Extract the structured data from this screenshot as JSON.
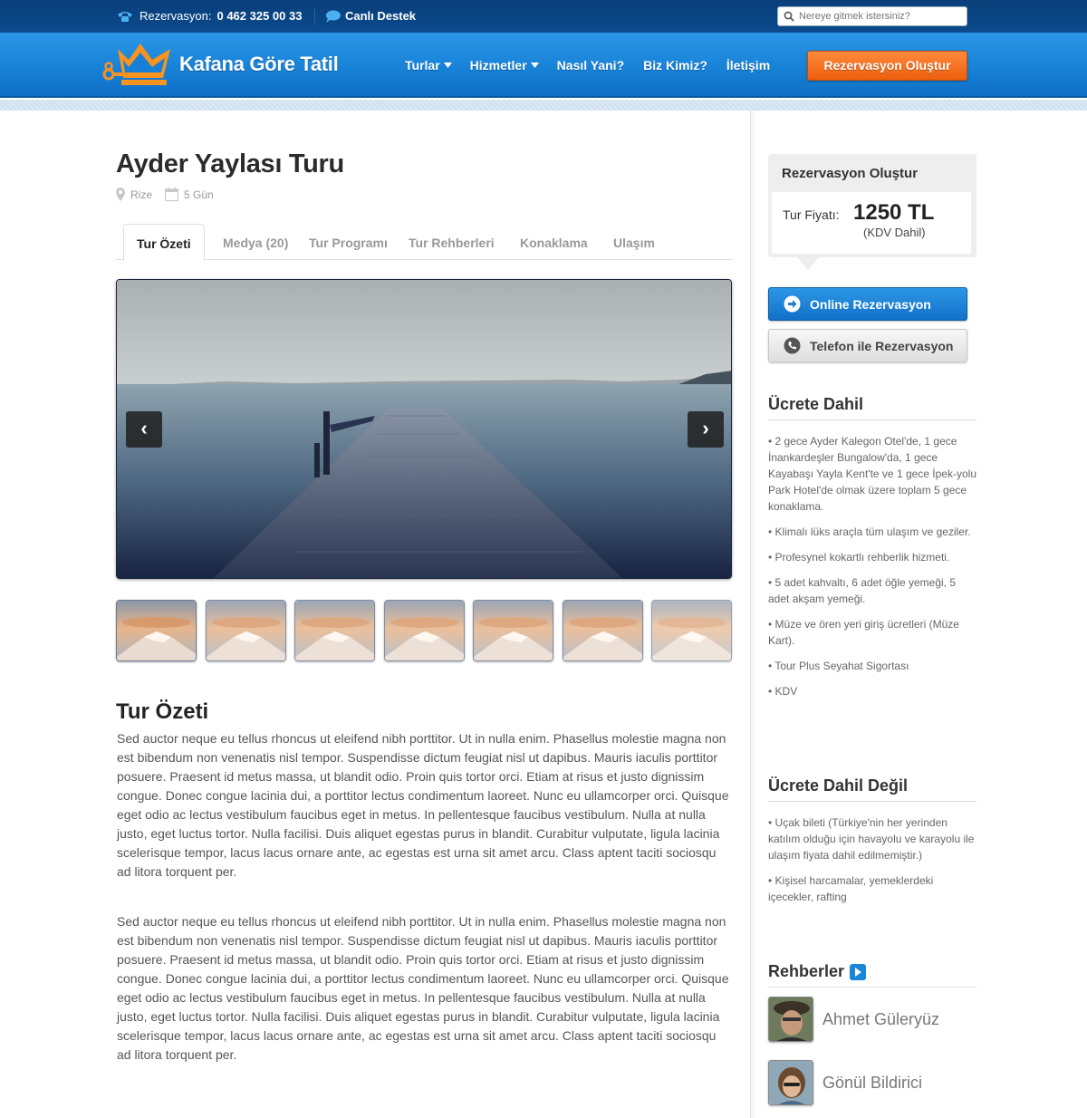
{
  "topbar": {
    "reservation_label": "Rezervasyon:",
    "phone": "0 462 325 00 33",
    "support": "Canlı Destek",
    "search_placeholder": "Nereye gitmek istersiniz?"
  },
  "brand": {
    "name": "Kafana Göre Tatil"
  },
  "nav": {
    "items": [
      "Turlar",
      "Hizmetler",
      "Nasıl Yani?",
      "Biz Kimiz?",
      "İletişim"
    ],
    "cta": "Rezervasyon Oluştur"
  },
  "tour": {
    "title": "Ayder Yaylası Turu",
    "location": "Rize",
    "duration": "5 Gün"
  },
  "tabs": [
    "Tur Özeti",
    "Medya (20)",
    "Tur Programı",
    "Tur Rehberleri",
    "Konaklama",
    "Ulaşım"
  ],
  "summary": {
    "heading": "Tur Özeti",
    "paragraphs": [
      "Sed auctor neque eu tellus rhoncus ut eleifend nibh porttitor. Ut in nulla enim. Phasellus molestie magna non est bibendum non venenatis nisl tempor. Suspendisse dictum feugiat nisl ut dapibus. Mauris iaculis porttitor posuere. Praesent id metus massa, ut blandit odio. Proin quis tortor orci. Etiam at risus et justo dignissim congue. Donec congue lacinia dui, a porttitor lectus condimentum laoreet. Nunc eu ullamcorper orci. Quisque eget odio ac lectus vestibulum faucibus eget in metus. In pellentesque faucibus vestibulum. Nulla at nulla justo, eget luctus tortor. Nulla facilisi. Duis aliquet egestas purus in blandit. Curabitur vulputate, ligula lacinia scelerisque tempor, lacus lacus ornare ante, ac egestas est urna sit amet arcu. Class aptent taciti sociosqu ad litora torquent per.",
      "Sed auctor neque eu tellus rhoncus ut eleifend nibh porttitor. Ut in nulla enim. Phasellus molestie magna non est bibendum non venenatis nisl tempor. Suspendisse dictum feugiat nisl ut dapibus. Mauris iaculis porttitor posuere. Praesent id metus massa, ut blandit odio. Proin quis tortor orci. Etiam at risus et justo dignissim congue. Donec congue lacinia dui, a porttitor lectus condimentum laoreet. Nunc eu ullamcorper orci. Quisque eget odio ac lectus vestibulum faucibus eget in metus. In pellentesque faucibus vestibulum. Nulla at nulla justo, eget luctus tortor. Nulla facilisi. Duis aliquet egestas purus in blandit. Curabitur vulputate, ligula lacinia scelerisque tempor, lacus lacus ornare ante, ac egestas est urna sit amet arcu. Class aptent taciti sociosqu ad litora torquent per."
    ]
  },
  "reservation": {
    "heading": "Rezervasyon Oluştur",
    "price_label": "Tur Fiyatı:",
    "price": "1250 TL",
    "price_note": "(KDV Dahil)",
    "online_button": "Online Rezervasyon",
    "phone_button": "Telefon ile Rezervasyon"
  },
  "included": {
    "heading": "Ücrete Dahil",
    "items": [
      "2 gece Ayder Kalegon Otel'de, 1 gece İnankardeşler Bungalow'da, 1 gece Kayabaşı Yayla Kent'te ve 1 gece İpek-yolu Park Hotel'de olmak üzere toplam 5 gece konaklama.",
      "Klimalı lüks araçla tüm ulaşım ve geziler.",
      "Profesynel kokartlı rehberlik hizmeti.",
      "5 adet kahvaltı, 6 adet öğle yemeği, 5 adet akşam yemeği.",
      "Müze ve ören yeri giriş ücretleri (Müze Kart).",
      "Tour Plus Seyahat Sigortası",
      "KDV"
    ]
  },
  "excluded": {
    "heading": "Ücrete Dahil Değil",
    "items": [
      "Uçak bileti (Türkiye'nin her yerinden katılım olduğu için havayolu ve karayolu ile ulaşım fiyata dahil edilmemiştir.)",
      "Kişisel harcamalar, yemeklerdeki içecekler, rafting"
    ]
  },
  "guides": {
    "heading": "Rehberler",
    "people": [
      "Ahmet Güleryüz",
      "Gönül Bildirici"
    ]
  },
  "colors": {
    "topbar": "#0b4a8d",
    "nav": "#1a86da",
    "cta": "#f26b1d",
    "online_button": "#1a7fd3"
  }
}
